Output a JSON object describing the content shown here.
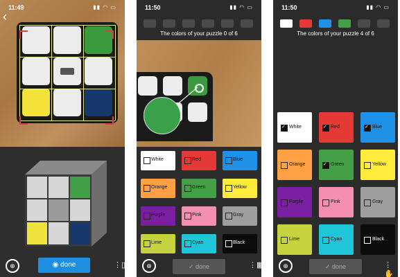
{
  "screen1": {
    "time": "11:49",
    "done_label": "done"
  },
  "screen2": {
    "time": "11:50",
    "heading": "The colors of your puzzle 0 of 6",
    "colors": [
      {
        "label": "White",
        "color": "#ffffff",
        "text": "#111111",
        "checked": false
      },
      {
        "label": "Red",
        "color": "#e53935",
        "text": "#111111",
        "checked": false
      },
      {
        "label": "Blue",
        "color": "#1e90e6",
        "text": "#111111",
        "checked": false
      },
      {
        "label": "Orange",
        "color": "#ffa142",
        "text": "#111111",
        "checked": false
      },
      {
        "label": "Green",
        "color": "#43a047",
        "text": "#111111",
        "checked": false
      },
      {
        "label": "Yellow",
        "color": "#ffeb3b",
        "text": "#111111",
        "checked": false
      },
      {
        "label": "Purple",
        "color": "#7b1fa2",
        "text": "#111111",
        "checked": false
      },
      {
        "label": "Pink",
        "color": "#f48fb1",
        "text": "#111111",
        "checked": false
      },
      {
        "label": "Gray",
        "color": "#9e9e9e",
        "text": "#111111",
        "checked": false
      },
      {
        "label": "Lime",
        "color": "#c6d23e",
        "text": "#111111",
        "checked": false
      },
      {
        "label": "Cyan",
        "color": "#1ec6d8",
        "text": "#111111",
        "checked": false
      },
      {
        "label": "Black",
        "color": "#0b0b0b",
        "text": "#ffffff",
        "checked": false
      }
    ],
    "done_label": "done"
  },
  "screen3": {
    "time": "11:50",
    "heading": "The colors of your puzzle 4 of 6",
    "swatches": [
      "#ffffff",
      "#e53935",
      "#1e90e6",
      "#43a047",
      "#4a4a4a",
      "#4a4a4a"
    ],
    "colors": [
      {
        "label": "White",
        "color": "#ffffff",
        "text": "#111111",
        "checked": true
      },
      {
        "label": "Red",
        "color": "#e53935",
        "text": "#111111",
        "checked": true
      },
      {
        "label": "Blue",
        "color": "#1e90e6",
        "text": "#111111",
        "checked": true
      },
      {
        "label": "Orange",
        "color": "#ffa142",
        "text": "#111111",
        "checked": false
      },
      {
        "label": "Green",
        "color": "#43a047",
        "text": "#111111",
        "checked": true
      },
      {
        "label": "Yellow",
        "color": "#ffeb3b",
        "text": "#111111",
        "checked": false
      },
      {
        "label": "Purple",
        "color": "#7b1fa2",
        "text": "#111111",
        "checked": false
      },
      {
        "label": "Pink",
        "color": "#f48fb1",
        "text": "#111111",
        "checked": false
      },
      {
        "label": "Gray",
        "color": "#9e9e9e",
        "text": "#111111",
        "checked": false
      },
      {
        "label": "Lime",
        "color": "#c6d23e",
        "text": "#111111",
        "checked": false
      },
      {
        "label": "Cyan",
        "color": "#1ec6d8",
        "text": "#111111",
        "checked": false
      },
      {
        "label": "Black",
        "color": "#0b0b0b",
        "text": "#ffffff",
        "checked": false
      }
    ],
    "done_label": "done"
  }
}
